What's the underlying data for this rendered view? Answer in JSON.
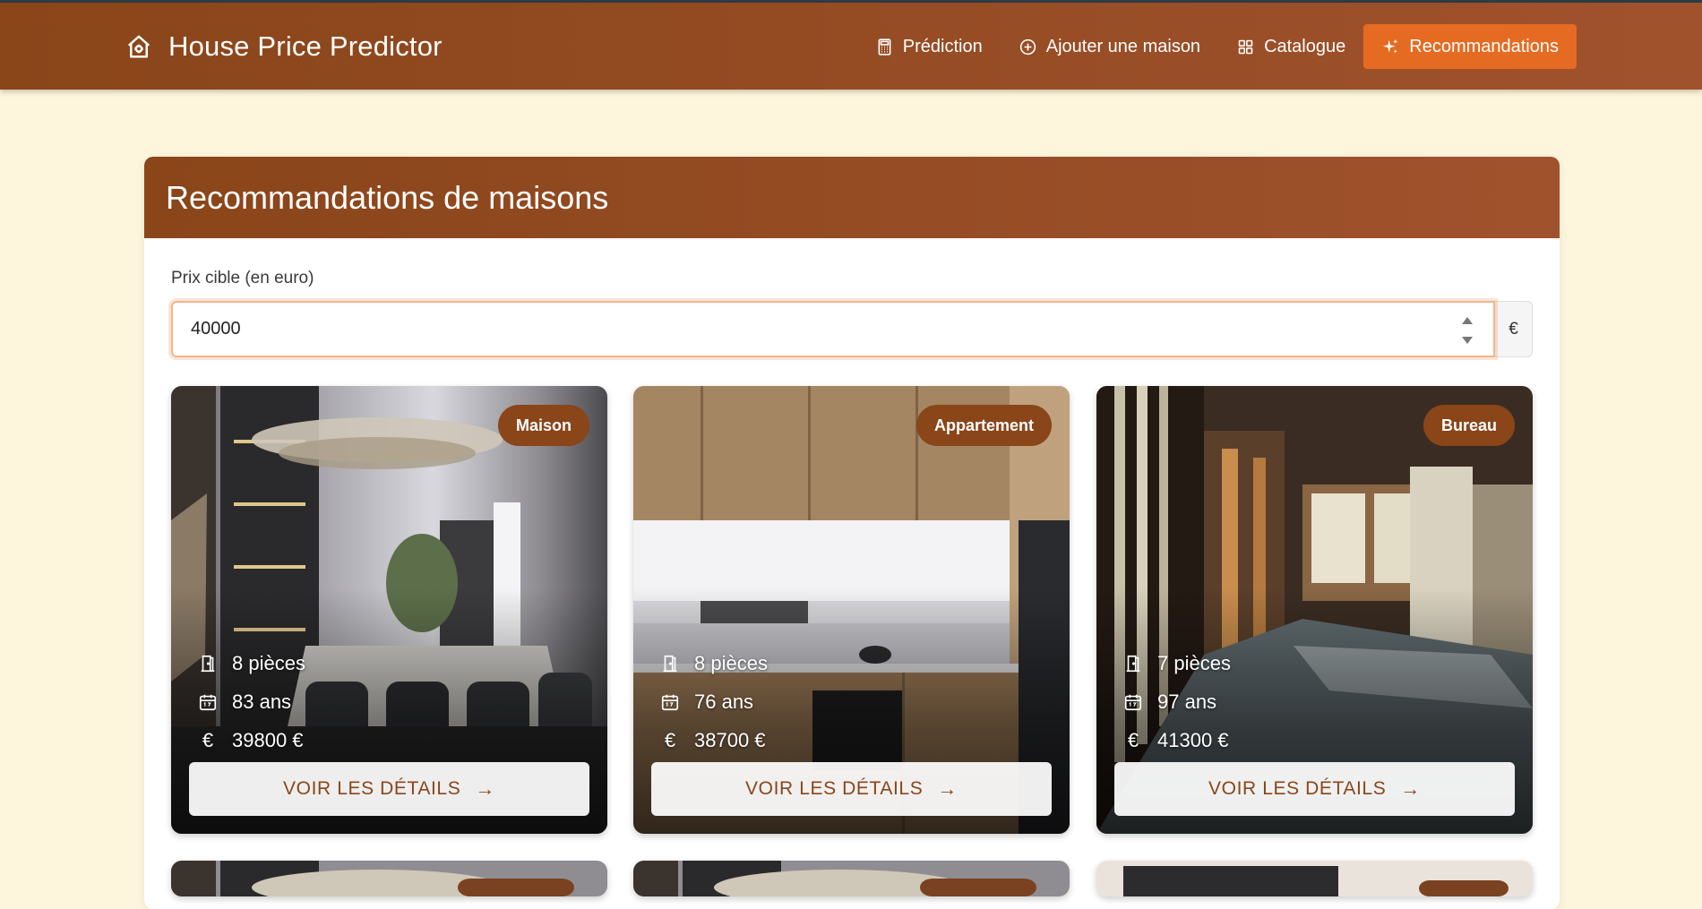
{
  "app": {
    "title": "House Price Predictor",
    "brand_icon": "house-gear-icon"
  },
  "nav": {
    "items": [
      {
        "label": "Prédiction",
        "icon": "calculator-icon"
      },
      {
        "label": "Ajouter une maison",
        "icon": "plus-circle-icon"
      },
      {
        "label": "Catalogue",
        "icon": "grid-icon"
      },
      {
        "label": "Recommandations",
        "icon": "sparkles-icon",
        "active": true
      }
    ]
  },
  "page": {
    "title": "Recommandations de maisons",
    "price_label": "Prix cible (en euro)",
    "price_value": "40000",
    "currency": "€"
  },
  "houses": [
    {
      "type": "Maison",
      "rooms": "8 pièces",
      "age": "83 ans",
      "price": "39800 €",
      "button": "VOIR LES DÉTAILS"
    },
    {
      "type": "Appartement",
      "rooms": "8 pièces",
      "age": "76 ans",
      "price": "38700 €",
      "button": "VOIR LES DÉTAILS"
    },
    {
      "type": "Bureau",
      "rooms": "7 pièces",
      "age": "97 ans",
      "price": "41300 €",
      "button": "VOIR LES DÉTAILS"
    }
  ],
  "colors": {
    "brand": "#8a4519",
    "accent": "#e56b22",
    "background": "#fdf5dc"
  }
}
